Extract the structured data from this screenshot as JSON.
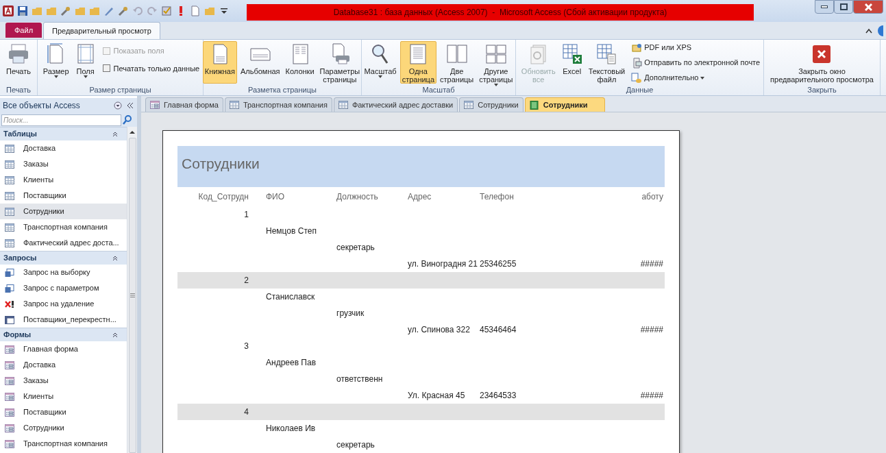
{
  "window": {
    "title": "Database31 : база данных (Access 2007)  -  Microsoft Access (Сбой активации продукта)"
  },
  "ribbon_tabs": [
    {
      "label": "Файл",
      "kind": "file",
      "selected": false
    },
    {
      "label": "Предварительный просмотр",
      "kind": "tab",
      "selected": true
    }
  ],
  "ribbon_groups": [
    {
      "label": "Печать",
      "items": [
        {
          "kind": "large",
          "label": "Печать",
          "selected": false,
          "disabled": false,
          "dropdown": false
        }
      ]
    },
    {
      "label": "Размер страницы",
      "items": [
        {
          "kind": "large",
          "label": "Размер",
          "selected": false,
          "disabled": false,
          "dropdown": true
        },
        {
          "kind": "large",
          "label": "Поля",
          "selected": false,
          "disabled": false,
          "dropdown": true
        },
        {
          "kind": "checks",
          "items": [
            {
              "label": "Показать поля",
              "checked": false,
              "disabled": true
            },
            {
              "label": "Печатать только данные",
              "checked": false,
              "disabled": false
            }
          ]
        }
      ]
    },
    {
      "label": "Разметка страницы",
      "items": [
        {
          "kind": "large",
          "label": "Книжная",
          "selected": true,
          "disabled": false,
          "dropdown": false
        },
        {
          "kind": "large",
          "label": "Альбомная",
          "selected": false,
          "disabled": false,
          "dropdown": false
        },
        {
          "kind": "large",
          "label": "Колонки",
          "selected": false,
          "disabled": false,
          "dropdown": false
        },
        {
          "kind": "large",
          "label": "Параметры\nстраницы",
          "selected": false,
          "disabled": false,
          "dropdown": false
        }
      ]
    },
    {
      "label": "Масштаб",
      "items": [
        {
          "kind": "large",
          "label": "Масштаб",
          "selected": false,
          "disabled": false,
          "dropdown": true
        },
        {
          "kind": "large",
          "label": "Одна\nстраница",
          "selected": true,
          "disabled": false,
          "dropdown": false
        },
        {
          "kind": "large",
          "label": "Две\nстраницы",
          "selected": false,
          "disabled": false,
          "dropdown": false
        },
        {
          "kind": "large",
          "label": "Другие\nстраницы",
          "selected": false,
          "disabled": false,
          "dropdown": true
        }
      ]
    },
    {
      "label": "Данные",
      "items": [
        {
          "kind": "large",
          "label": "Обновить\nвсе",
          "selected": false,
          "disabled": true,
          "dropdown": false
        },
        {
          "kind": "large",
          "label": "Excel",
          "selected": false,
          "disabled": false,
          "dropdown": false
        },
        {
          "kind": "large",
          "label": "Текстовый\nфайл",
          "selected": false,
          "disabled": false,
          "dropdown": false
        },
        {
          "kind": "smalls",
          "items": [
            {
              "label": "PDF или XPS",
              "dropdown": false
            },
            {
              "label": "Отправить по электронной почте",
              "dropdown": false
            },
            {
              "label": "Дополнительно",
              "dropdown": true
            }
          ]
        }
      ]
    },
    {
      "label": "Закрыть",
      "items": [
        {
          "kind": "large",
          "label": "Закрыть окно\nпредварительного просмотра",
          "selected": false,
          "disabled": false,
          "dropdown": false
        }
      ]
    }
  ],
  "navigation": {
    "title": "Все объекты Access",
    "search_placeholder": "Поиск...",
    "sections": [
      {
        "title": "Таблицы",
        "kind": "table",
        "items": [
          {
            "label": "Доставка",
            "selected": false
          },
          {
            "label": "Заказы",
            "selected": false
          },
          {
            "label": "Клиенты",
            "selected": false
          },
          {
            "label": "Поставщики",
            "selected": false
          },
          {
            "label": "Сотрудники",
            "selected": true
          },
          {
            "label": "Транспортная компания",
            "selected": false
          },
          {
            "label": "Фактический адрес доста...",
            "selected": false
          }
        ]
      },
      {
        "title": "Запросы",
        "kind": "query",
        "items": [
          {
            "label": "Запрос на выборку",
            "selected": false
          },
          {
            "label": "Запрос с параметром",
            "selected": false
          },
          {
            "label": "Запрос на удаление",
            "selected": false
          },
          {
            "label": "Поставщики_перекрестн...",
            "selected": false
          }
        ]
      },
      {
        "title": "Формы",
        "kind": "form",
        "items": [
          {
            "label": "Главная форма",
            "selected": false
          },
          {
            "label": "Доставка",
            "selected": false
          },
          {
            "label": "Заказы",
            "selected": false
          },
          {
            "label": "Клиенты",
            "selected": false
          },
          {
            "label": "Поставщики",
            "selected": false
          },
          {
            "label": "Сотрудники",
            "selected": false
          },
          {
            "label": "Транспортная компания",
            "selected": false
          }
        ]
      }
    ]
  },
  "document_tabs": [
    {
      "label": "Главная форма",
      "kind": "form",
      "selected": false
    },
    {
      "label": "Транспортная компания",
      "kind": "table",
      "selected": false
    },
    {
      "label": "Фактический адрес доставки",
      "kind": "table",
      "selected": false
    },
    {
      "label": "Сотрудники",
      "kind": "table",
      "selected": false
    },
    {
      "label": "Сотрудники",
      "kind": "report",
      "selected": true
    }
  ],
  "report": {
    "title": "Сотрудники",
    "columns": [
      "Код_Сотрудн",
      "ФИО",
      "Должность",
      "Адрес",
      "Телефон",
      "аботу"
    ],
    "records": [
      {
        "id": "1",
        "name": "Немцов Степ",
        "position": "секретарь",
        "address": "ул. Виноградня 21",
        "phone": "25346255",
        "column_6": "#####",
        "shaded": false
      },
      {
        "id": "2",
        "name": "Станиславск",
        "position": "грузчик",
        "address": "ул. Спинова 322",
        "phone": "45346464",
        "column_6": "#####",
        "shaded": true
      },
      {
        "id": "3",
        "name": "Андреев Пав",
        "position": "ответственн",
        "address": "Ул. Красная 45",
        "phone": "23464533",
        "column_6": "#####",
        "shaded": false
      },
      {
        "id": "4",
        "name": "Николаев Ив",
        "position": "секретарь",
        "shaded": true
      }
    ]
  }
}
